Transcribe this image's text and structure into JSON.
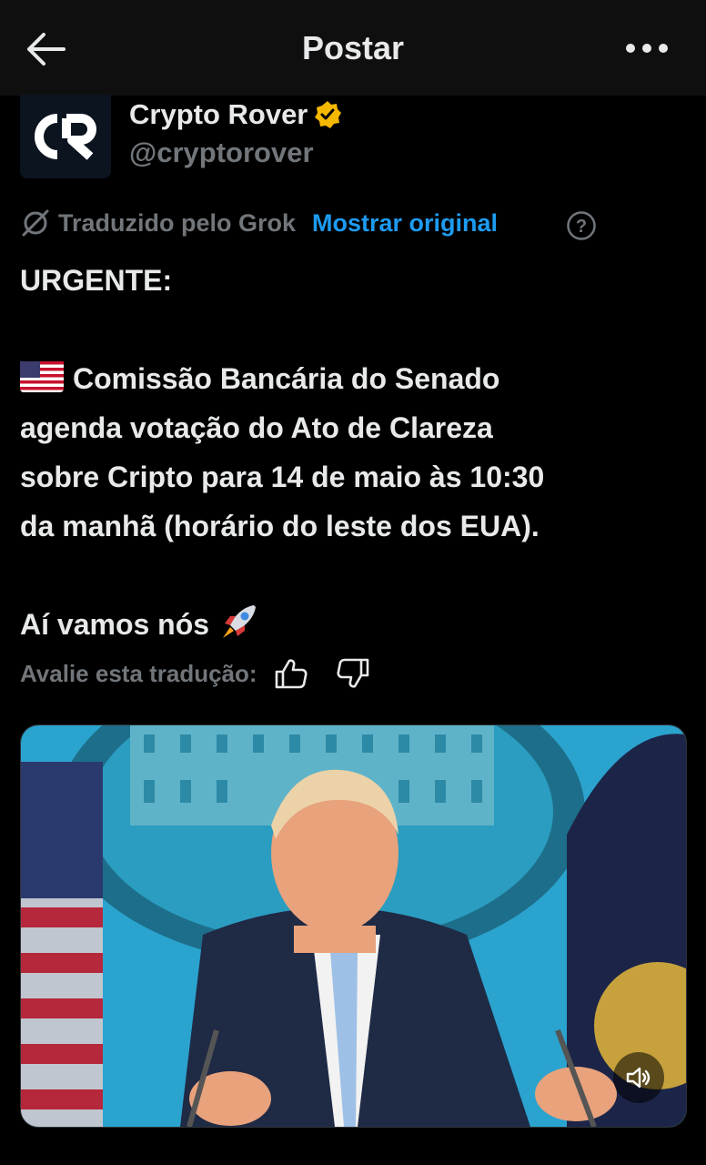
{
  "header": {
    "title": "Postar",
    "back_icon": "arrow-left-icon",
    "more_icon": "more-horizontal-icon"
  },
  "author": {
    "name": "Crypto Rover",
    "handle": "@cryptorover",
    "avatar_initials": "CR",
    "verified": true,
    "badge_color": "#f5b800"
  },
  "translation": {
    "label": "Traduzido pelo Grok",
    "show_original": "Mostrar original",
    "help_icon": "question-circle-icon"
  },
  "post": {
    "line1": "URGENTE:",
    "paragraph_lines": [
      "Comissão Bancária do Senado",
      "agenda votação do Ato de Clareza",
      "sobre Cripto para 14 de maio às 10:30",
      "da manhã (horário do leste dos EUA)."
    ],
    "closing": "Aí vamos nós"
  },
  "rating": {
    "label": "Avalie esta tradução:"
  },
  "media": {
    "type": "video",
    "volume_icon": "speaker-icon"
  },
  "colors": {
    "accent": "#1d9bf0",
    "background": "#000000",
    "muted": "#71767b"
  }
}
